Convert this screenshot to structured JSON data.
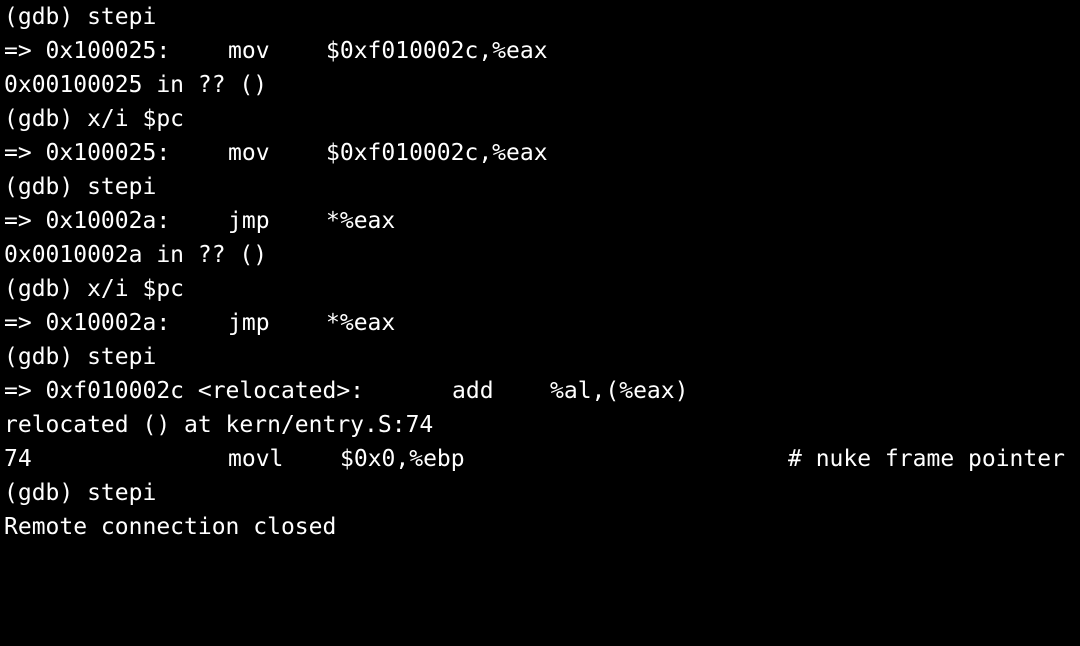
{
  "colors": {
    "background": "#000000",
    "foreground": "#ffffff"
  },
  "terminal": {
    "lines": [
      {
        "text": "(gdb) stepi"
      },
      {
        "addr": "=> 0x100025:",
        "op": "mov",
        "args": "$0xf010002c,%eax"
      },
      {
        "text": "0x00100025 in ?? ()"
      },
      {
        "text": "(gdb) x/i $pc"
      },
      {
        "addr": "=> 0x100025:",
        "op": "mov",
        "args": "$0xf010002c,%eax"
      },
      {
        "text": "(gdb) stepi"
      },
      {
        "addr": "=> 0x10002a:",
        "op": "jmp",
        "args": "*%eax"
      },
      {
        "text": "0x0010002a in ?? ()"
      },
      {
        "text": "(gdb) x/i $pc"
      },
      {
        "addr": "=> 0x10002a:",
        "op": "jmp",
        "args": "*%eax"
      },
      {
        "text": "(gdb) stepi"
      },
      {
        "addr": "=> 0xf010002c <relocated>:",
        "op": "add",
        "args": "%al,(%eax)"
      },
      {
        "text": "relocated () at kern/entry.S:74"
      },
      {
        "lineno": "74",
        "op": "movl",
        "args": "$0x0,%ebp",
        "comment": "# nuke frame pointer"
      },
      {
        "text": "(gdb) stepi"
      },
      {
        "text": "Remote connection closed"
      }
    ]
  }
}
